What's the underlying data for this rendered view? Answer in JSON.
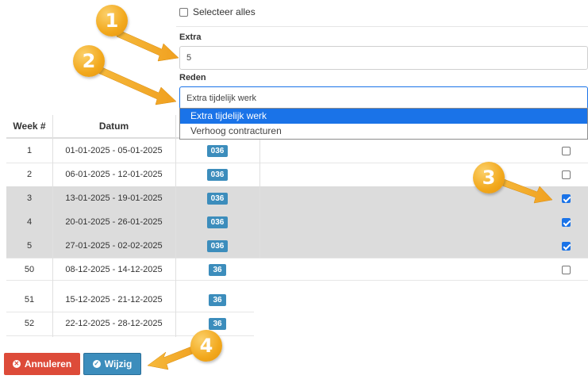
{
  "form": {
    "select_all_label": "Selecteer alles",
    "extra_label": "Extra",
    "extra_value": "5",
    "reden_label": "Reden",
    "reden_value": "Extra tijdelijk werk",
    "reden_options": [
      "Extra tijdelijk werk",
      "Verhoog contracturen"
    ]
  },
  "table": {
    "headers": {
      "week": "Week #",
      "datum": "Datum"
    },
    "rows": [
      {
        "week": "1",
        "datum": "01-01-2025 - 05-01-2025",
        "badge": "036",
        "checked": false
      },
      {
        "week": "2",
        "datum": "06-01-2025 - 12-01-2025",
        "badge": "036",
        "checked": false
      },
      {
        "week": "3",
        "datum": "13-01-2025 - 19-01-2025",
        "badge": "036",
        "checked": true
      },
      {
        "week": "4",
        "datum": "20-01-2025 - 26-01-2025",
        "badge": "036",
        "checked": true
      },
      {
        "week": "5",
        "datum": "27-01-2025 - 02-02-2025",
        "badge": "036",
        "checked": true
      },
      {
        "week": "50",
        "datum": "08-12-2025 - 14-12-2025",
        "badge": "36",
        "checked": false
      },
      {
        "week": "51",
        "datum": "15-12-2025 - 21-12-2025",
        "badge": "36"
      },
      {
        "week": "52",
        "datum": "22-12-2025 - 28-12-2025",
        "badge": "36"
      }
    ]
  },
  "buttons": {
    "cancel_label": "Annuleren",
    "save_label": "Wijzig"
  },
  "markers": [
    "1",
    "2",
    "3",
    "4"
  ],
  "colors": {
    "accent": "#1a73e8",
    "badge": "#3c8dbc",
    "danger": "#dd4b39",
    "marker": "#f2a81c",
    "selected_row": "#dcdcdc"
  }
}
